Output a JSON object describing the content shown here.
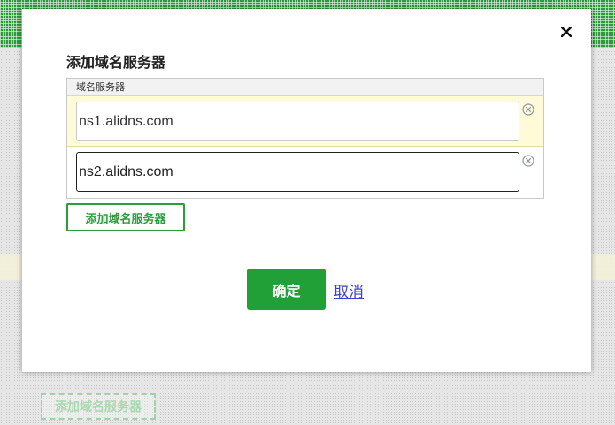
{
  "background": {
    "ghost_button_label": "添加域名服务器"
  },
  "dialog": {
    "title": "添加域名服务器",
    "table_header": "域名服务器",
    "nameservers": [
      {
        "value": "ns1.alidns.com"
      },
      {
        "value": "ns2.alidns.com"
      }
    ],
    "add_button_label": "添加域名服务器",
    "confirm_label": "确定",
    "cancel_label": "取消"
  },
  "colors": {
    "primary_green": "#22a038",
    "link_blue": "#3a3fd0",
    "row_highlight": "#fffad7"
  },
  "icons": {
    "close": "close-icon",
    "remove": "circle-x-icon"
  }
}
